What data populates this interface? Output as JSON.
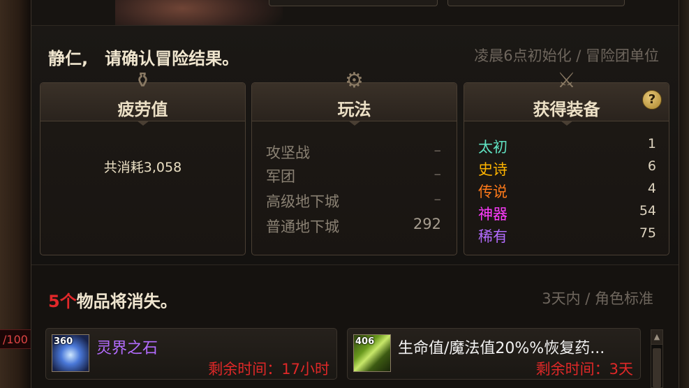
{
  "left_hp": "/100",
  "header": {
    "title": "静仁,　请确认冒险结果。",
    "reset_note": "凌晨6点初始化 / 冒险团单位"
  },
  "cards": {
    "fatigue": {
      "title": "疲劳值",
      "text": "共消耗3,058"
    },
    "play": {
      "title": "玩法",
      "rows": [
        {
          "label": "攻坚战",
          "value": "–"
        },
        {
          "label": "军团",
          "value": "–"
        },
        {
          "label": "高级地下城",
          "value": "–"
        },
        {
          "label": "普通地下城",
          "value": "292"
        }
      ]
    },
    "equipment": {
      "title": "获得装备",
      "help": "?",
      "rows": [
        {
          "label": "太初",
          "value": "1",
          "color": "#5fe0c0"
        },
        {
          "label": "史诗",
          "value": "6",
          "color": "#ffb400"
        },
        {
          "label": "传说",
          "value": "4",
          "color": "#ff7a1a"
        },
        {
          "label": "神器",
          "value": "54",
          "color": "#ff3cff"
        },
        {
          "label": "稀有",
          "value": "75",
          "color": "#b36cff"
        }
      ]
    }
  },
  "vanish": {
    "count": "5个",
    "title_rest": "物品将消失。",
    "note": "3天内 / 角色标准",
    "items": [
      {
        "badge": "360",
        "name": "灵界之石",
        "name_color": "#b36cff",
        "time": "剩余时间：17小时",
        "icon": "spirit-stone-icon"
      },
      {
        "badge": "406",
        "name": "生命值/魔法值20%%恢复药...",
        "name_color": "#f2f2f2",
        "time": "剩余时间：3天",
        "icon": "potion-icon"
      }
    ]
  },
  "scroll_up": "▲"
}
